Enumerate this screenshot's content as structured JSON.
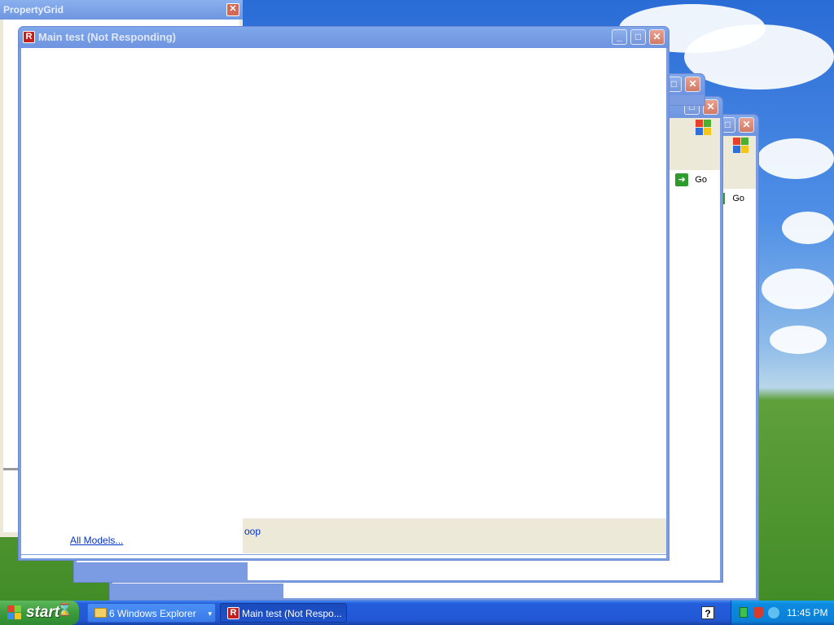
{
  "property_grid": {
    "title": "PropertyGrid"
  },
  "main_window": {
    "title": "Main test (Not Responding)",
    "status_link": "All Models...",
    "status_fragment": "oop"
  },
  "background_windows": {
    "go_label": "Go"
  },
  "taskbar": {
    "start_label": "start",
    "explorer_group_label": "6 Windows Explorer",
    "main_test_label": "Main test (Not Respo...",
    "help_label": "?",
    "clock": "11:45 PM"
  },
  "colors": {
    "xp_blue": "#0a53d6",
    "close_red": "#c5442a",
    "start_green": "#3c9a3c"
  },
  "icons": {
    "app": "r-app-icon",
    "windows_logo": "windows-flag-icon",
    "go": "green-arrow-icon",
    "folder": "folder-icon"
  }
}
